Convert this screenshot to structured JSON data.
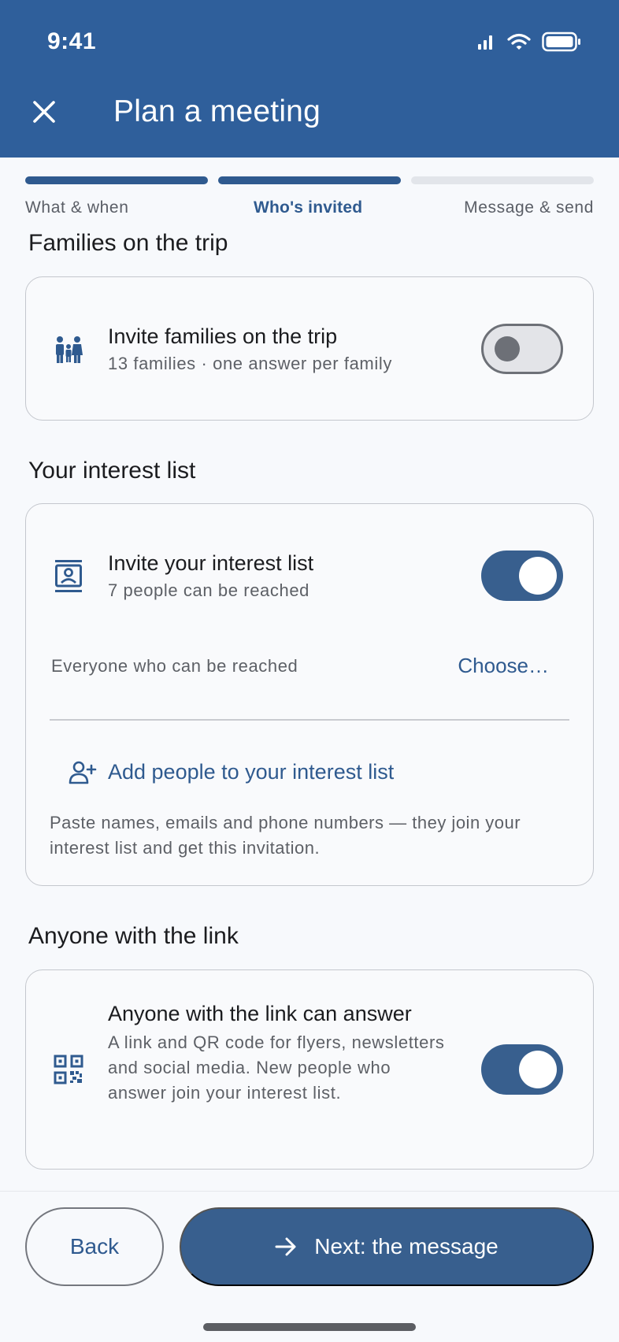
{
  "status_bar": {
    "time": "9:41",
    "icons": [
      "signal-icon",
      "wifi-icon",
      "battery-icon"
    ]
  },
  "header": {
    "title": "Plan a meeting",
    "close_icon": "close-icon"
  },
  "stepper": {
    "steps": [
      {
        "label": "What & when",
        "state": "done"
      },
      {
        "label": "Who's invited",
        "state": "current"
      },
      {
        "label": "Message & send",
        "state": "upcoming"
      }
    ]
  },
  "families": {
    "section_title": "Families on the trip",
    "title": "Invite families on the trip",
    "subtitle": "13 families · one answer per family",
    "toggle_on": false,
    "icon": "family-icon"
  },
  "interest": {
    "section_title": "Your interest list",
    "title": "Invite your interest list",
    "subtitle": "7 people can be reached",
    "toggle_on": true,
    "icon": "contact-card-icon",
    "reach_label": "Everyone who can be reached",
    "choose_label": "Choose…",
    "add_label": "Add people to your interest list",
    "add_icon": "add-person-icon",
    "help_text": "Paste names, emails and phone numbers — they join your interest list and get this invitation."
  },
  "link": {
    "section_title": "Anyone with the link",
    "title": "Anyone with the link can answer",
    "subtitle": "A link and QR code for flyers, newsletters and social media. New people who answer join your interest list.",
    "toggle_on": true,
    "icon": "qr-code-icon"
  },
  "footer": {
    "back_label": "Back",
    "next_label": "Next: the message",
    "next_icon": "arrow-right-icon"
  },
  "colors": {
    "header": "#2f5f9b",
    "accent": "#2f5a8f",
    "toggle_on": "#385f8e",
    "background": "#f7f9fc"
  }
}
